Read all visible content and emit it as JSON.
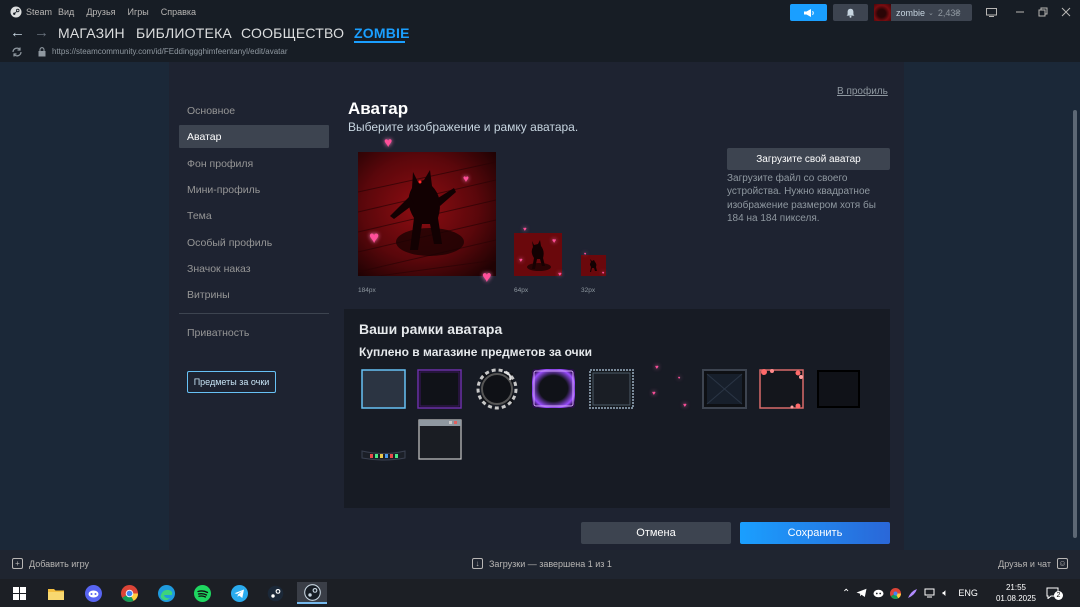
{
  "menubar": {
    "app_name": "Steam",
    "items": [
      "Вид",
      "Друзья",
      "Игры",
      "Справка"
    ],
    "user_name": "zombie",
    "balance": "2,43₴"
  },
  "nav": {
    "links": [
      "МАГАЗИН",
      "БИБЛИОТЕКА",
      "СООБЩЕСТВО",
      "ZOMBIE"
    ]
  },
  "url": "https://steamcommunity.com/id/FEddinggghimfeentanyl/edit/avatar",
  "sidebar": {
    "items": [
      "Основное",
      "Аватар",
      "Фон профиля",
      "Мини-профиль",
      "Тема",
      "Особый профиль",
      "Значок наказ",
      "Витрины"
    ],
    "privacy": "Приватность",
    "points_button": "Предметы за очки"
  },
  "main": {
    "to_profile": "В профиль",
    "title": "Аватар",
    "subtitle": "Выберите изображение и рамку аватара.",
    "size_captions": [
      "184px",
      "64px",
      "32px"
    ],
    "upload_button": "Загрузите свой аватар",
    "upload_hint": "Загрузите файл со своего устройства. Нужно квадратное изображение размером хотя бы 184 на 184 пикселя."
  },
  "frames": {
    "title": "Ваши рамки аватара",
    "subtitle": "Куплено в магазине предметов за очки"
  },
  "actions": {
    "cancel": "Отмена",
    "save": "Сохранить"
  },
  "bottombar": {
    "add_game": "Добавить игру",
    "downloads": "Загрузки — завершена 1 из 1",
    "friends": "Друзья и чат"
  },
  "taskbar": {
    "language": "ENG",
    "time": "21:55",
    "date": "01.08.2025"
  },
  "colors": {
    "accent": "#1a9fff",
    "background": "#1b2838",
    "panel": "#171b24",
    "heart": "#ff4f9a"
  }
}
